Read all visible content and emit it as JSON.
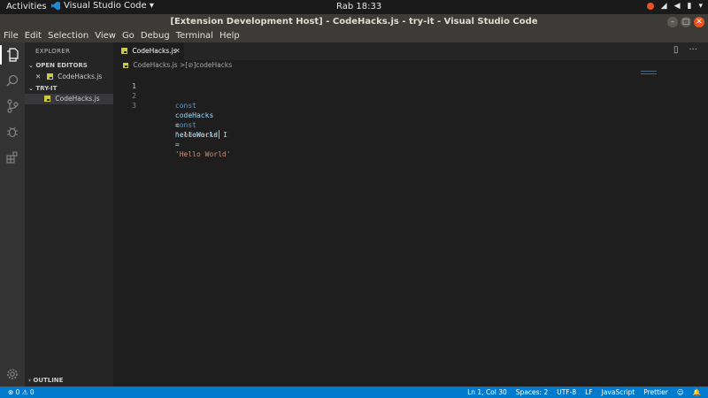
{
  "system": {
    "activities": "Activities",
    "app_name": "Visual Studio Code ▾",
    "clock": "Rab 18:33"
  },
  "window": {
    "title": "[Extension Development Host] - CodeHacks.js - try-it - Visual Studio Code"
  },
  "menu": [
    "File",
    "Edit",
    "Selection",
    "View",
    "Go",
    "Debug",
    "Terminal",
    "Help"
  ],
  "sidebar": {
    "title": "EXPLORER",
    "open_editors_label": "OPEN EDITORS",
    "open_editors": [
      {
        "close": "✕",
        "name": "CodeHacks.js"
      }
    ],
    "folder_label": "TRY-IT",
    "files": [
      {
        "name": "CodeHacks.js"
      }
    ],
    "outline_label": "OUTLINE"
  },
  "editor": {
    "tab_label": "CodeHacks.js",
    "tab_close": "✕",
    "breadcrumb_file": "CodeHacks.js",
    "breadcrumb_separator": ">",
    "breadcrumb_symbol": "[⊘]codeHacks",
    "lines": [
      {
        "number": "1",
        "keyword": "const",
        "name": "codeHacks",
        "op": "=",
        "string": "'codeHacks"
      },
      {
        "number": "2"
      },
      {
        "number": "3",
        "keyword": "const",
        "name": "helloWorld",
        "op": "=",
        "string": "'Hello World'"
      }
    ]
  },
  "status": {
    "problems": "⊗ 0 ⚠ 0",
    "position": "Ln 1, Col 30",
    "spaces": "Spaces: 2",
    "encoding": "UTF-8",
    "eol": "LF",
    "language": "JavaScript",
    "prettier": "Prettier",
    "feedback": "☺",
    "bell": "🔔"
  },
  "colors": {
    "accent": "#007acc",
    "sidebar": "#252526",
    "editor_bg": "#1e1e1e",
    "keyword": "#569cd6",
    "string": "#ce9178"
  }
}
